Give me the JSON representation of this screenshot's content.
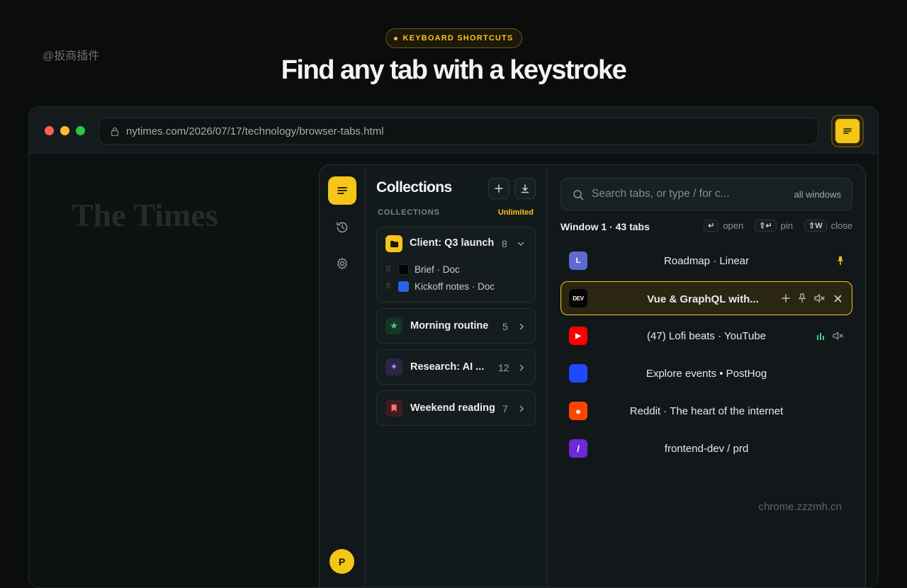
{
  "watermark": "@扳商插件",
  "badge": {
    "label": "KEYBOARD SHORTCUTS"
  },
  "headline": "Find any tab with a keystroke",
  "browser": {
    "url": "nytimes.com/2026/07/17/technology/browser-tabs.html",
    "site_title": "The Times"
  },
  "rail": {
    "avatar_initial": "P"
  },
  "collections": {
    "title": "Collections",
    "section_label": "COLLECTIONS",
    "plan_label": "Unlimited",
    "items": [
      {
        "name": "Client: Q3 launch",
        "count": "8",
        "expanded": true,
        "icon": "folder-icon",
        "color": "#f5c518",
        "tabs": [
          {
            "title": "Brief · Doc",
            "icon_color": "#050505"
          },
          {
            "title": "Kickoff notes · Doc",
            "icon_color": "#2563eb"
          }
        ]
      },
      {
        "name": "Morning routine",
        "count": "5",
        "icon": "star-icon",
        "color": "#3ecf8e"
      },
      {
        "name": "Research: AI ...",
        "count": "12",
        "icon": "sparkle-icon",
        "color": "#a78bfa"
      },
      {
        "name": "Weekend reading",
        "count": "7",
        "icon": "bookmark-icon",
        "color": "#f87171"
      }
    ]
  },
  "tabs": {
    "search_placeholder": "Search tabs, or type / for c...",
    "scope": "all windows",
    "window_label": "Window 1 · 43 tabs",
    "shortcuts": [
      {
        "key": "↵",
        "label": "open"
      },
      {
        "key": "⇧↵",
        "label": "pin"
      },
      {
        "key": "⇧W",
        "label": "close"
      }
    ],
    "rows": [
      {
        "title": "Roadmap · Linear",
        "favicon_text": "L",
        "favicon_color": "#5e6ad2"
      },
      {
        "title": "Vue & GraphQL with...",
        "favicon_text": "DEV",
        "favicon_color": "#050505",
        "selected": true
      },
      {
        "title": "(47) Lofi beats · YouTube",
        "favicon_text": "▶",
        "favicon_color": "#ff0000"
      },
      {
        "title": "Explore events • PostHog",
        "favicon_text": "",
        "favicon_color": "#1d4aff"
      },
      {
        "title": "Reddit · The heart of the internet",
        "favicon_text": "●",
        "favicon_color": "#ff4500"
      },
      {
        "title": "frontend-dev / prd",
        "favicon_text": "/",
        "favicon_color": "#6d28d9"
      }
    ],
    "footer_watermark": "chrome.zzzmh.cn"
  },
  "colors": {
    "accent": "#f5c518",
    "background": "#0b0c0c",
    "panel": "#121819"
  }
}
